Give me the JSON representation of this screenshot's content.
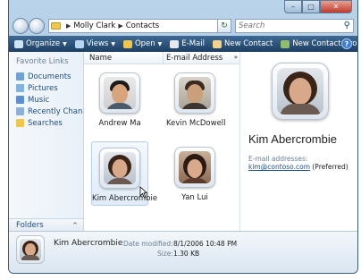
{
  "window": {
    "minimize": "–",
    "maximize": "□",
    "close": "✕"
  },
  "breadcrumb": [
    "Molly Clark",
    "Contacts"
  ],
  "search": {
    "placeholder": "Search"
  },
  "toolbar": {
    "items": [
      {
        "label": "Organize",
        "icon": "organize-icon",
        "dropdown": true,
        "color": "#cfe3f7"
      },
      {
        "label": "Views",
        "icon": "views-icon",
        "dropdown": true,
        "color": "#b9d7f2"
      },
      {
        "label": "Open",
        "icon": "open-icon",
        "dropdown": true,
        "color": "#f0c64b"
      },
      {
        "label": "E-Mail",
        "icon": "email-icon",
        "dropdown": false,
        "color": "#e5e9ee"
      },
      {
        "label": "New Contact",
        "icon": "new-contact-icon",
        "dropdown": false,
        "color": "#f3d38a"
      },
      {
        "label": "New Contact Group",
        "icon": "new-contact-group-icon",
        "dropdown": false,
        "color": "#8fbf6a"
      }
    ],
    "more": "»",
    "help": "?"
  },
  "nav_pane": {
    "title": "Favorite Links",
    "items": [
      {
        "label": "Documents",
        "icon": "documents-icon",
        "color": "#6fa3d6"
      },
      {
        "label": "Pictures",
        "icon": "pictures-icon",
        "color": "#7fb3e0"
      },
      {
        "label": "Music",
        "icon": "music-icon",
        "color": "#5b8fd0"
      },
      {
        "label": "Recently Chan...",
        "icon": "recently-changed-icon",
        "color": "#8fb0d6"
      },
      {
        "label": "Searches",
        "icon": "searches-icon",
        "color": "#f0c64b"
      }
    ],
    "folders_label": "Folders",
    "folders_caret": "^"
  },
  "columns": {
    "name": "Name",
    "email": "E-mail Address",
    "more": "»"
  },
  "contacts": [
    {
      "name": "Andrew Ma"
    },
    {
      "name": "Kevin McDowell"
    },
    {
      "name": "Kim Abercrombie"
    },
    {
      "name": "Yan Lui"
    }
  ],
  "preview": {
    "name": "Kim Abercrombie",
    "email_label": "E-mail addresses:",
    "email": "kim@contoso.com",
    "email_suffix": " (Preferred)"
  },
  "details": {
    "name": "Kim Abercrombie",
    "date_label": "Date modified:",
    "date_value": "8/1/2006 10:48 PM",
    "size_label": "Size:",
    "size_value": "1.30 KB"
  },
  "colors": {
    "accent": "#1a4e8a",
    "toolbar": "#2a537c",
    "selection": "#e0ecf8"
  }
}
